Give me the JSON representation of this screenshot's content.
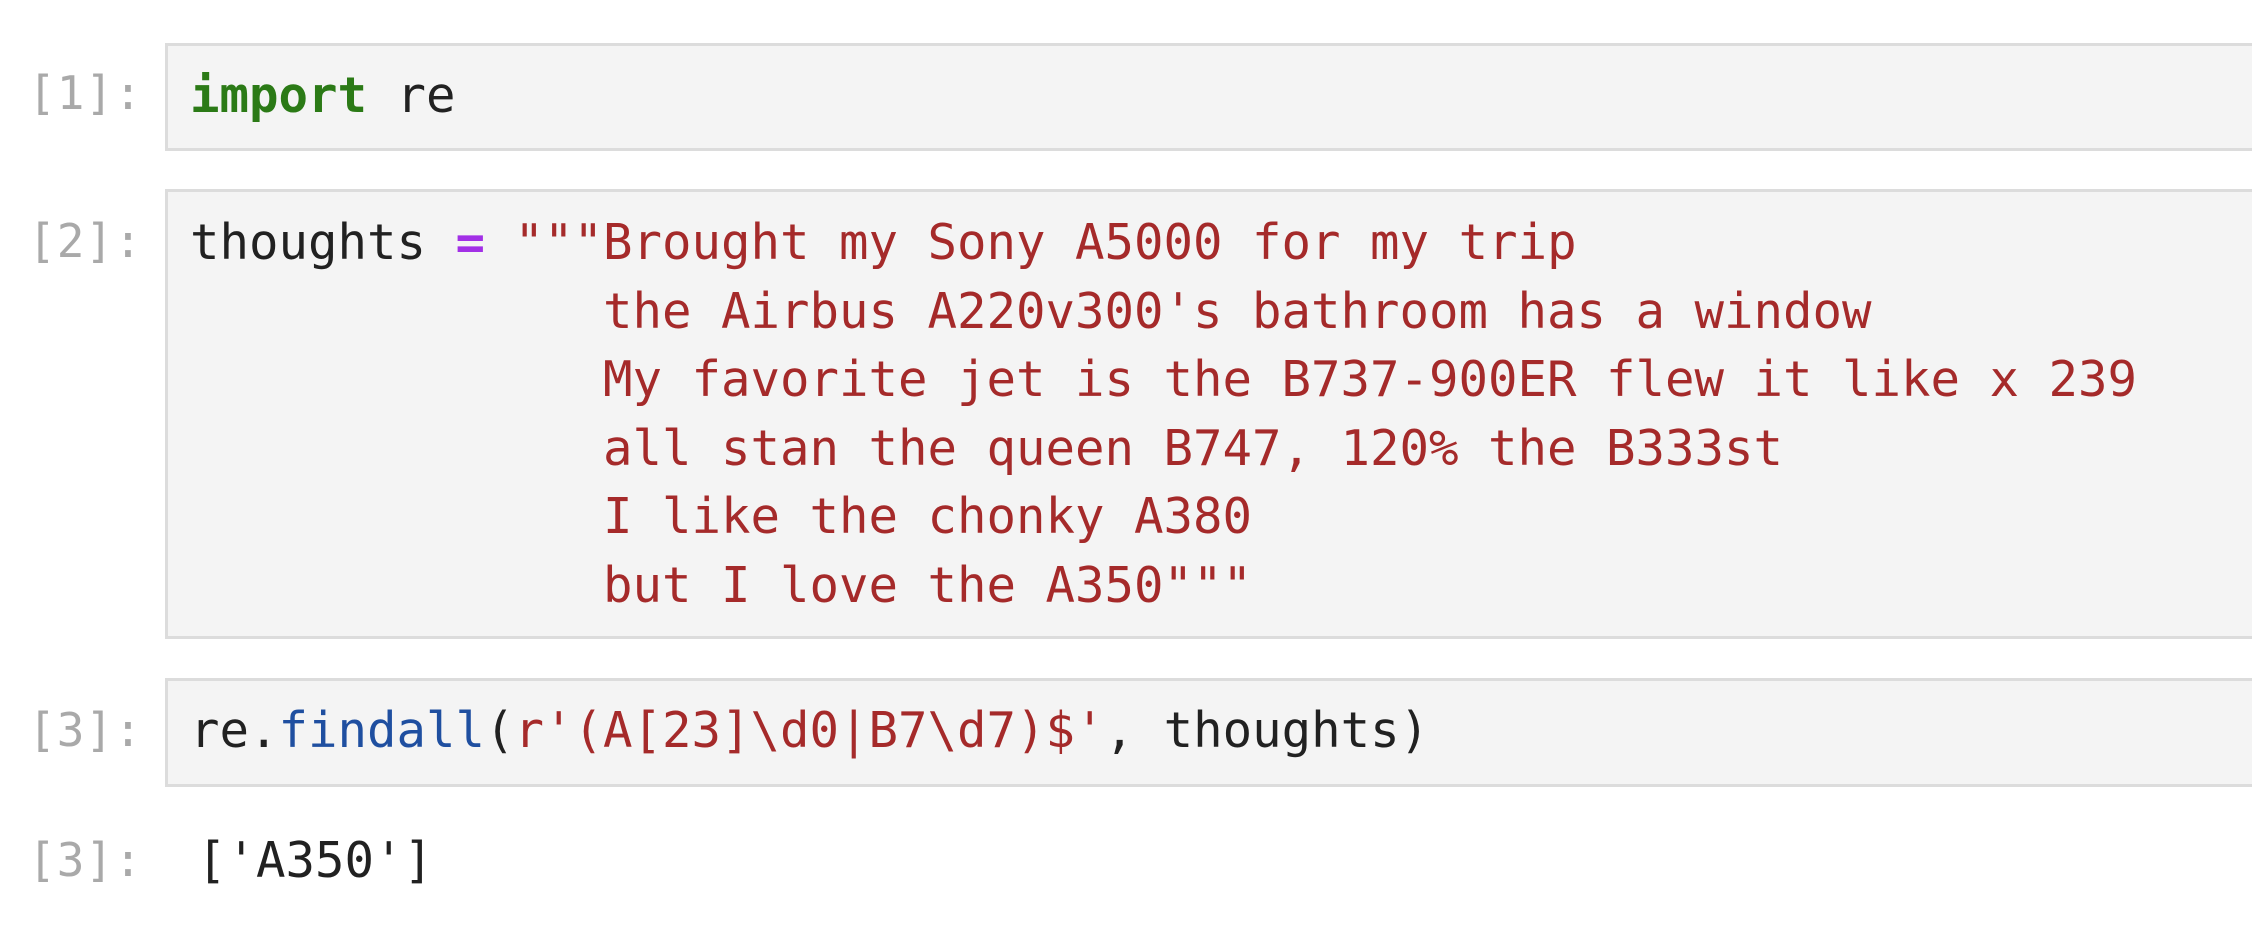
{
  "cells": [
    {
      "prompt": "[1]:",
      "code": {
        "keyword": "import",
        "module": " re"
      }
    },
    {
      "prompt": "[2]:",
      "code": {
        "var": "thoughts ",
        "op": "=",
        "space": " ",
        "lines": [
          "\"\"\"Brought my Sony A5000 for my trip",
          "              the Airbus A220v300's bathroom has a window",
          "              My favorite jet is the B737-900ER flew it like x 239",
          "              all stan the queen B747, 120% the B333st",
          "              I like the chonky A380",
          "              but I love the A350\"\"\""
        ]
      }
    },
    {
      "prompt": "[3]:",
      "code": {
        "obj": "re.",
        "fn": "findall",
        "open": "(",
        "pattern": "r'(A[23]\\d0|B7\\d7)$'",
        "rest": ", thoughts)"
      }
    }
  ],
  "outputs": [
    {
      "prompt": "[3]:",
      "text": "['A350']"
    }
  ],
  "colors": {
    "keyword": "#2b7a16",
    "operator": "#a230e6",
    "string": "#a52a2a",
    "function": "#1f4fa0",
    "prompt": "#a9a9a9",
    "editor_bg": "#f4f4f4",
    "editor_border": "#dcdcdc"
  }
}
